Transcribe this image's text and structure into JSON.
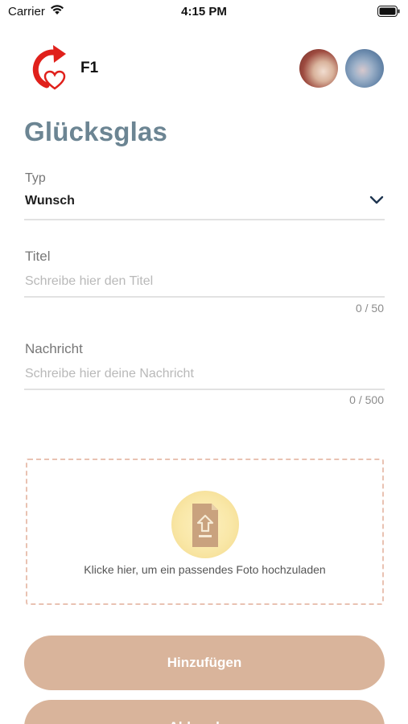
{
  "status_bar": {
    "carrier": "Carrier",
    "time": "4:15 PM",
    "wifi_icon": "wifi-icon",
    "battery_icon": "battery-icon"
  },
  "header": {
    "app_name": "F1",
    "logo_icon": "share-heart-logo",
    "avatars": [
      "avatar-1",
      "avatar-2"
    ]
  },
  "page": {
    "title": "Glücksglas"
  },
  "form": {
    "type": {
      "label": "Typ",
      "value": "Wunsch",
      "icon": "chevron-down-icon"
    },
    "title": {
      "label": "Titel",
      "placeholder": "Schreibe hier den Titel",
      "counter": "0 / 50"
    },
    "message": {
      "label": "Nachricht",
      "placeholder": "Schreibe hier deine Nachricht",
      "counter": "0 / 500"
    },
    "upload": {
      "text": "Klicke hier, um ein passendes Foto hochzuladen",
      "icon": "upload-file-icon"
    }
  },
  "actions": {
    "add_label": "Hinzufügen",
    "cancel_label": "Abbrechen"
  },
  "colors": {
    "title": "#6c8593",
    "button": "#d9b49b",
    "upload_border": "#e9c2b2",
    "upload_circle": "#f9e7a7",
    "logo_red": "#e0201b"
  }
}
